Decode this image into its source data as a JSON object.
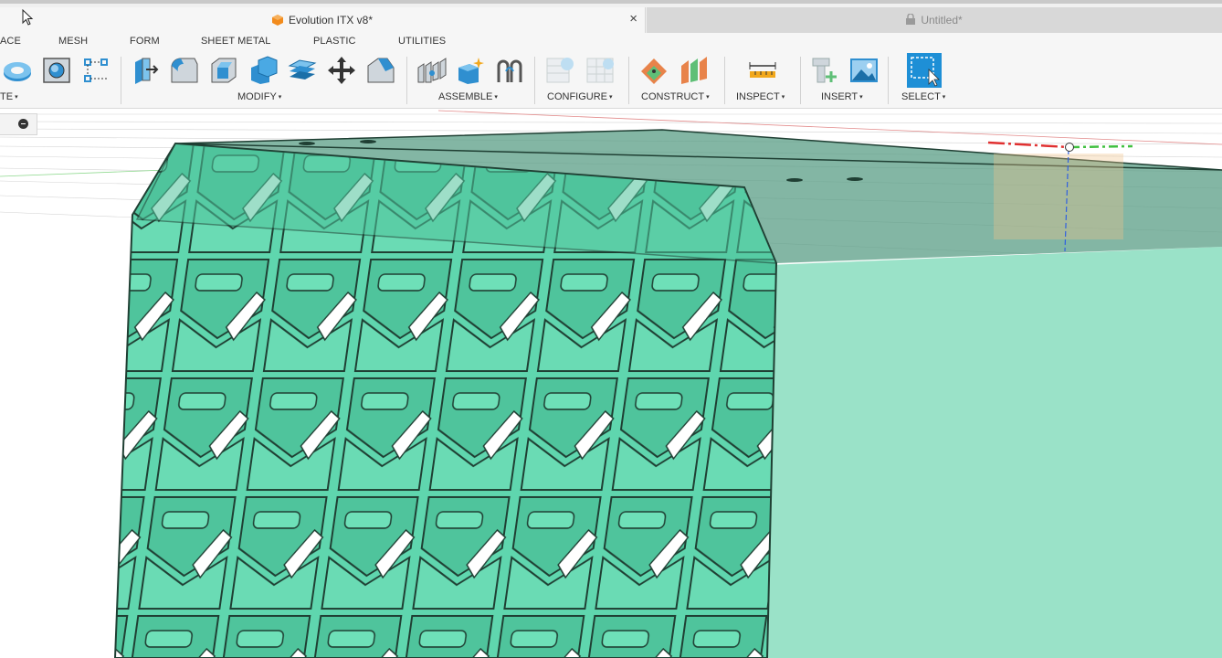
{
  "tabs": {
    "active": {
      "title": "Evolution ITX v8*",
      "close": "×"
    },
    "inactive": {
      "title": "Untitled*"
    }
  },
  "menu": [
    "ACE",
    "MESH",
    "FORM",
    "SHEET METAL",
    "PLASTIC",
    "UTILITIES"
  ],
  "toolbar": {
    "groups": [
      {
        "label": "TE",
        "caret": "▾"
      },
      {
        "label": "MODIFY",
        "caret": "▾"
      },
      {
        "label": "ASSEMBLE",
        "caret": "▾"
      },
      {
        "label": "CONFIGURE",
        "caret": "▾"
      },
      {
        "label": "CONSTRUCT",
        "caret": "▾"
      },
      {
        "label": "INSPECT",
        "caret": "▾"
      },
      {
        "label": "INSERT",
        "caret": "▾"
      },
      {
        "label": "SELECT",
        "caret": "▾"
      }
    ],
    "icons": [
      "revolve-icon",
      "hole-icon",
      "sketch-dimension-icon",
      "press-pull-icon",
      "fillet-icon",
      "shell-icon",
      "combine-icon",
      "offset-face-icon",
      "move-icon",
      "chamfer-icon",
      "joint-icon",
      "new-component-icon",
      "motion-link-icon",
      "configure-table-icon",
      "configure-grid-icon",
      "plane-icon",
      "midplane-icon",
      "measure-icon",
      "insert-mesh-icon",
      "insert-image-icon",
      "select-icon"
    ]
  },
  "colors": {
    "model_green": "#5fd6ae",
    "model_light": "#9ae2c8",
    "model_top": "#5a9e86",
    "accent_blue": "#1e8fd6"
  }
}
